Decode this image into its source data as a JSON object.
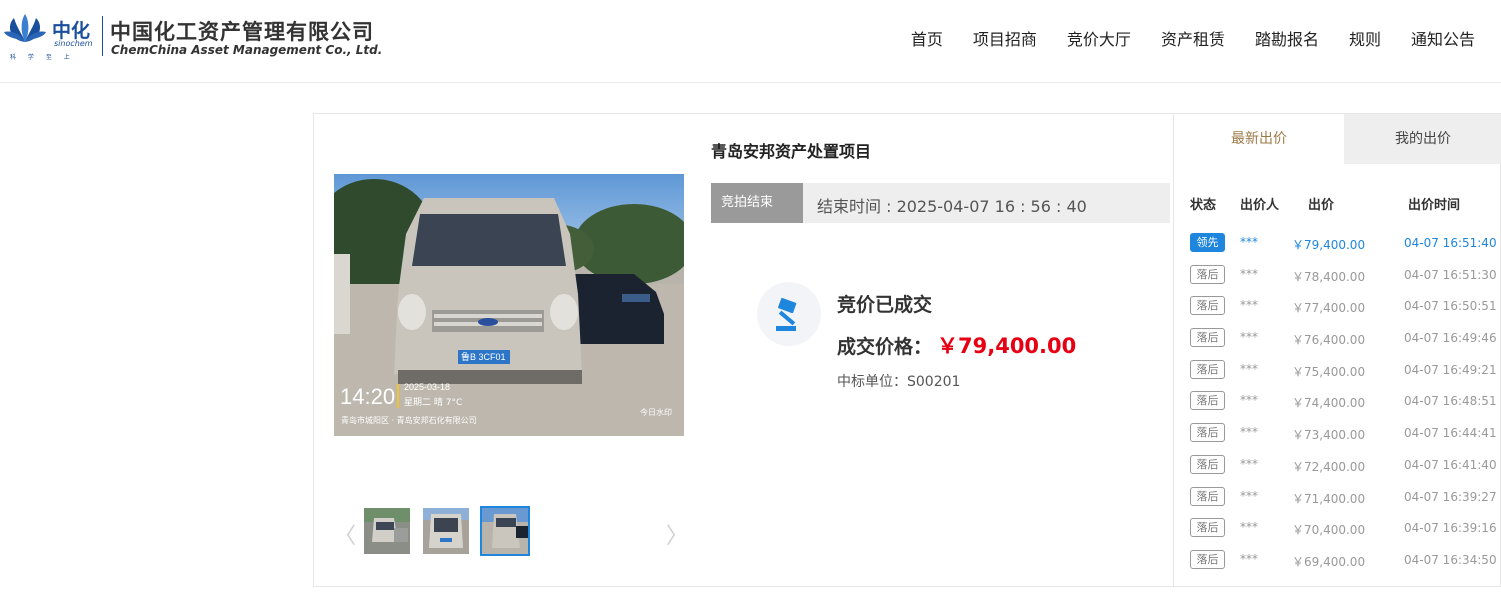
{
  "brand": {
    "short_cn": "中化",
    "short_en": "sinochem",
    "slogan": "科 学 至 上",
    "name_cn": "中国化工资产管理有限公司",
    "name_en": "ChemChina Asset Management Co., Ltd.",
    "color": "#1a4f9c"
  },
  "nav": {
    "items": [
      "首页",
      "项目招商",
      "竞价大厅",
      "资产租赁",
      "踏勘报名",
      "规则",
      "通知公告"
    ]
  },
  "photo": {
    "time": "14:20",
    "date": "2025-03-18",
    "weekday_weather": "星期二 晴 7°C",
    "location": "青岛市城阳区 · 青岛安邦石化有限公司",
    "plate": "鲁B 3CF01",
    "watermark": "今日水印"
  },
  "thumbs": {
    "prev": "〈",
    "next": "〉"
  },
  "project": {
    "title": "青岛安邦资产处置项目",
    "status": "竞拍结束",
    "end_time": "结束时间 : 2025-04-07 16 : 56 : 40"
  },
  "deal": {
    "title": "竞价已成交",
    "price_label": "成交价格：",
    "price": "￥79,400.00",
    "winner": "中标单位：S00201"
  },
  "bids": {
    "tab_latest": "最新出价",
    "tab_mine": "我的出价",
    "col_status": "状态",
    "col_bidder": "出价人",
    "col_amount": "出价",
    "col_time": "出价时间",
    "rows": [
      {
        "status": "领先",
        "bidder": "***",
        "amount": "￥79,400.00",
        "time": "04-07 16:51:40"
      },
      {
        "status": "落后",
        "bidder": "***",
        "amount": "￥78,400.00",
        "time": "04-07 16:51:30"
      },
      {
        "status": "落后",
        "bidder": "***",
        "amount": "￥77,400.00",
        "time": "04-07 16:50:51"
      },
      {
        "status": "落后",
        "bidder": "***",
        "amount": "￥76,400.00",
        "time": "04-07 16:49:46"
      },
      {
        "status": "落后",
        "bidder": "***",
        "amount": "￥75,400.00",
        "time": "04-07 16:49:21"
      },
      {
        "status": "落后",
        "bidder": "***",
        "amount": "￥74,400.00",
        "time": "04-07 16:48:51"
      },
      {
        "status": "落后",
        "bidder": "***",
        "amount": "￥73,400.00",
        "time": "04-07 16:44:41"
      },
      {
        "status": "落后",
        "bidder": "***",
        "amount": "￥72,400.00",
        "time": "04-07 16:41:40"
      },
      {
        "status": "落后",
        "bidder": "***",
        "amount": "￥71,400.00",
        "time": "04-07 16:39:27"
      },
      {
        "status": "落后",
        "bidder": "***",
        "amount": "￥70,400.00",
        "time": "04-07 16:39:16"
      },
      {
        "status": "落后",
        "bidder": "***",
        "amount": "￥69,400.00",
        "time": "04-07 16:34:50"
      }
    ]
  },
  "colors": {
    "accent": "#1f86de",
    "price": "#e60012",
    "tab_active_text": "#9c7a47"
  }
}
